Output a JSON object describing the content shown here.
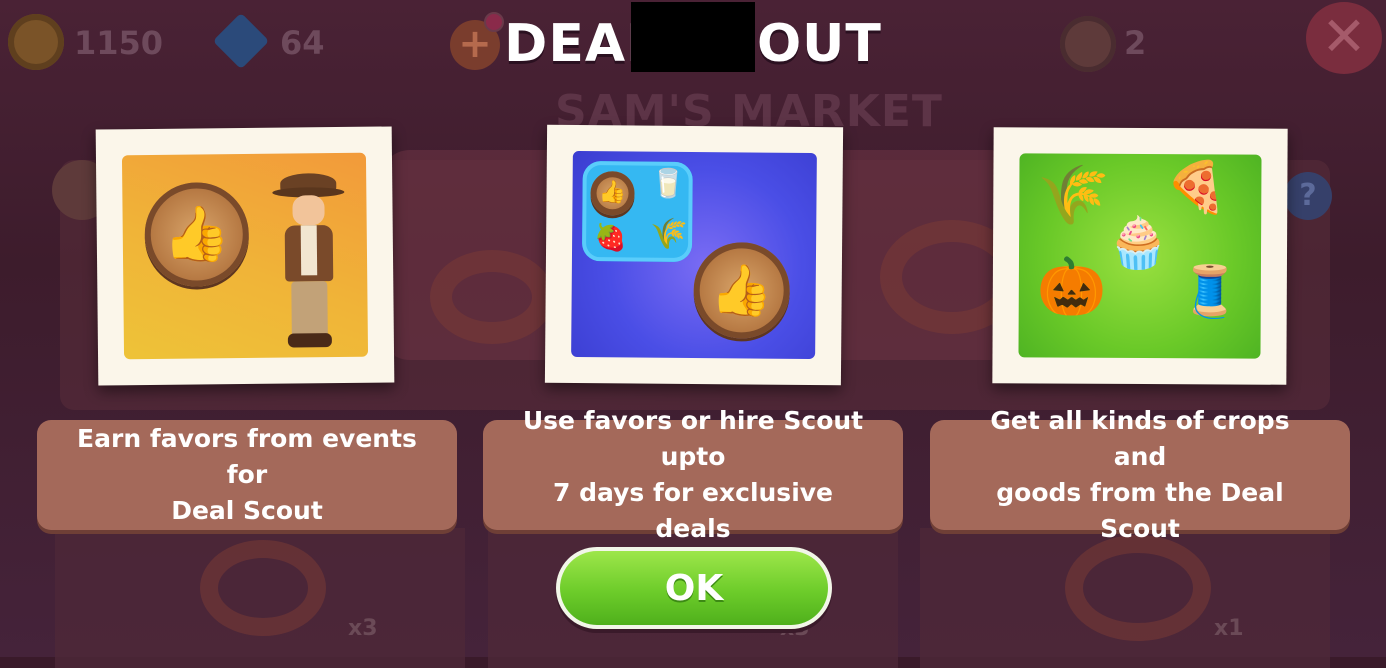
{
  "hud": {
    "coins": "1150",
    "gems": "64",
    "favors": "2"
  },
  "dialog": {
    "title": "DEAL SCOUT",
    "background_subtitle": "SAM'S MARKET",
    "cards": [
      {
        "text": "Earn favors from events for\nDeal Scout"
      },
      {
        "text": "Use favors or hire Scout upto\n7 days for exclusive deals"
      },
      {
        "text": "Get all kinds of crops and\ngoods from the Deal Scout"
      }
    ],
    "ok_label": "OK"
  },
  "background_items": {
    "counts": [
      "x3",
      "x3",
      "x1"
    ]
  },
  "icons": {
    "close": "close-icon",
    "help": "help-icon",
    "plus": "plus-icon"
  },
  "colors": {
    "card_background": "#a4695a",
    "ok_button": "#6dcc2a",
    "panel1_bg": "#f0b438",
    "panel2_bg": "#4a4ee6",
    "panel3_bg": "#6ac928"
  }
}
